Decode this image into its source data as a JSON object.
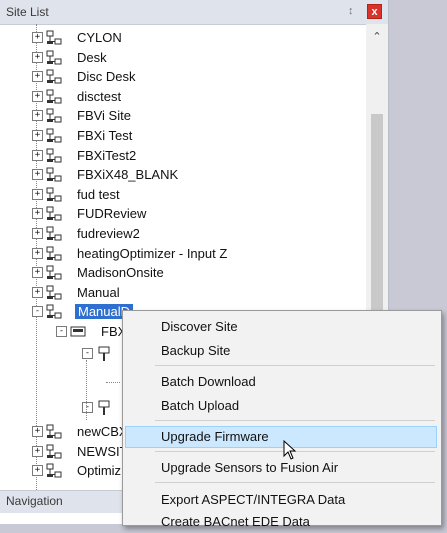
{
  "panel": {
    "title": "Site List",
    "pin_icon": "pin-icon",
    "close_icon": "close-icon",
    "close_glyph": "x"
  },
  "tree": {
    "sites": [
      {
        "label": "CYLON",
        "expander": "+"
      },
      {
        "label": "Desk",
        "expander": "+"
      },
      {
        "label": "Disc Desk",
        "expander": "+"
      },
      {
        "label": "disctest",
        "expander": "+"
      },
      {
        "label": "FBVi Site",
        "expander": "+"
      },
      {
        "label": "FBXi Test",
        "expander": "+"
      },
      {
        "label": "FBXiTest2",
        "expander": "+"
      },
      {
        "label": "FBXiX48_BLANK",
        "expander": "+"
      },
      {
        "label": "fud test",
        "expander": "+"
      },
      {
        "label": "FUDReview",
        "expander": "+"
      },
      {
        "label": "fudreview2",
        "expander": "+"
      },
      {
        "label": "heatingOptimizer - Input Z",
        "expander": "+"
      },
      {
        "label": "MadisonOnsite",
        "expander": "+"
      },
      {
        "label": "Manual",
        "expander": "+"
      },
      {
        "label": "ManualD",
        "expander": "-",
        "selected": true
      }
    ],
    "child_label": "FBX",
    "bottom_sites": [
      {
        "label": "newCBX",
        "expander": "+"
      },
      {
        "label": "NEWSIT",
        "expander": "+"
      },
      {
        "label": "Optimiz",
        "expander": "+"
      }
    ]
  },
  "navigation": {
    "label": "Navigation"
  },
  "context_menu": {
    "items": [
      {
        "label": "Discover Site"
      },
      {
        "label": "Backup Site"
      },
      {
        "label": "Batch Download"
      },
      {
        "label": "Batch Upload"
      },
      {
        "label": "Upgrade Firmware",
        "hovered": true
      },
      {
        "label": "Upgrade Sensors to Fusion Air"
      },
      {
        "label": "Export ASPECT/INTEGRA Data"
      },
      {
        "label": "Create BACnet EDE Data"
      }
    ]
  },
  "colors": {
    "selection": "#2f6fd0",
    "hover": "#cce8ff",
    "close": "#d9342b"
  }
}
